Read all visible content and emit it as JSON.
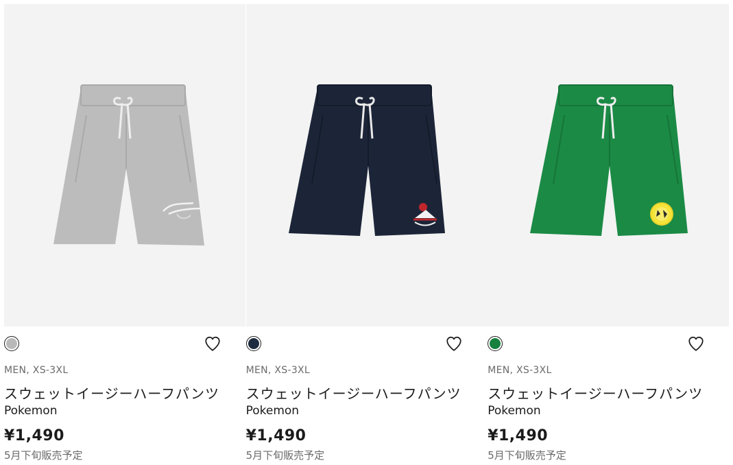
{
  "products": [
    {
      "color_name": "gray",
      "color": "#b9b9b9",
      "pants_color": "#bcbcbc",
      "pants_shade": "#a9a9a9",
      "category": "MEN, XS-3XL",
      "title": "スウェットイージーハーフパンツ",
      "brand": "Pokemon",
      "price": "¥1,490",
      "release": "5月下旬販売予定",
      "favorite_icon": "heart-outline-icon"
    },
    {
      "color_name": "navy",
      "color": "#1e2a3f",
      "pants_color": "#1c2538",
      "pants_shade": "#141b2a",
      "category": "MEN, XS-3XL",
      "title": "スウェットイージーハーフパンツ",
      "brand": "Pokemon",
      "price": "¥1,490",
      "release": "5月下旬販売予定",
      "favorite_icon": "heart-outline-icon"
    },
    {
      "color_name": "green",
      "color": "#16803f",
      "pants_color": "#1b8a45",
      "pants_shade": "#167438",
      "category": "MEN, XS-3XL",
      "title": "スウェットイージーハーフパンツ",
      "brand": "Pokemon",
      "price": "¥1,490",
      "release": "5月下旬販売予定",
      "favorite_icon": "heart-outline-icon"
    }
  ]
}
